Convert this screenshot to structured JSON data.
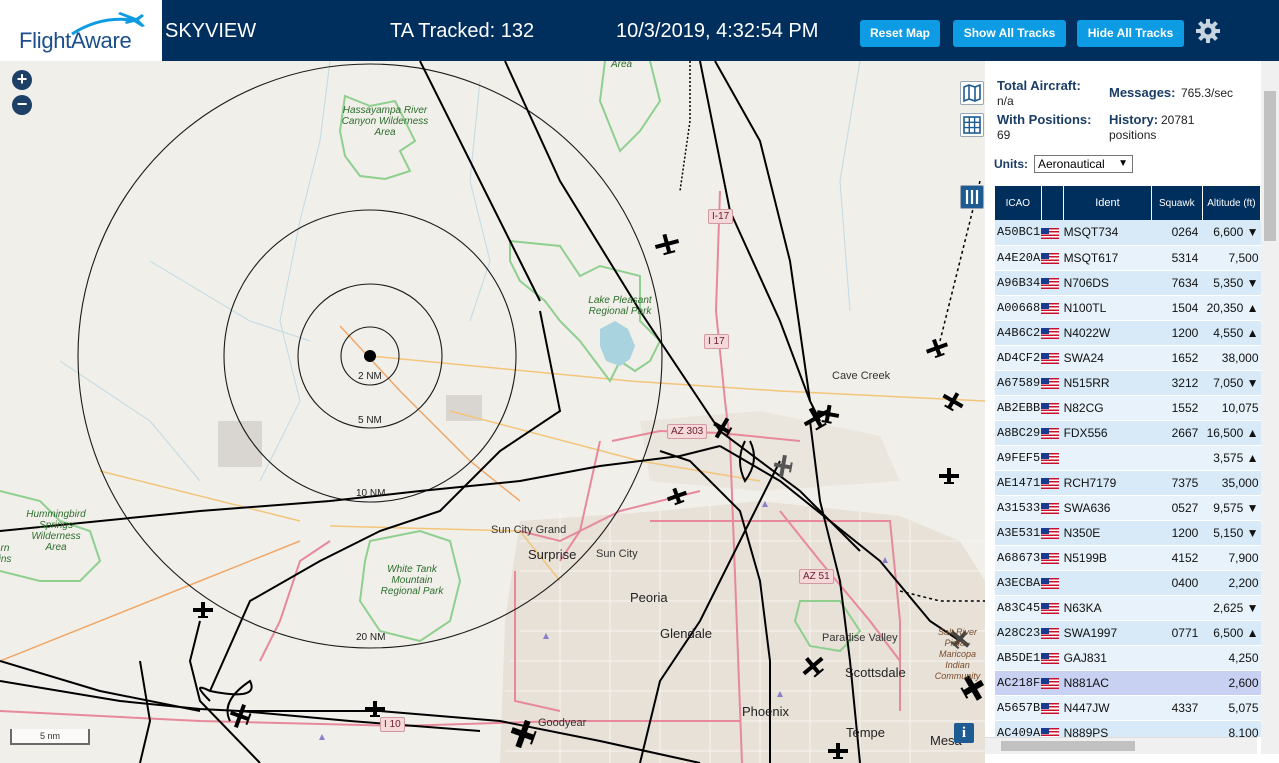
{
  "header": {
    "logo_text": "FlightAware",
    "title": "SKYVIEW",
    "tracked": "TA Tracked: 132",
    "datetime": "10/3/2019, 4:32:54 PM",
    "buttons": {
      "reset_map": "Reset Map",
      "show_all_tracks": "Show All Tracks",
      "hide_all_tracks": "Hide All Tracks"
    },
    "settings_icon": "gear-icon"
  },
  "map": {
    "zoom_in": "+",
    "zoom_out": "−",
    "scale": "5 nm",
    "info": "i",
    "range_rings": [
      "2 NM",
      "5 NM",
      "10 NM",
      "20 NM"
    ],
    "places": [
      "Cave Creek",
      "Sun City Grand",
      "Surprise",
      "Sun City",
      "Peoria",
      "Glendale",
      "Paradise Valley",
      "Scottsdale",
      "Phoenix",
      "Goodyear",
      "Tempe",
      "Mesa"
    ],
    "parks": [
      "Hassayampa River Canyon Wilderness Area",
      "Lake Pleasant Regional Park",
      "White Tank Mountain Regional Park",
      "Hummingbird Springs Wilderness Area",
      "Area",
      "rn ins",
      "Salt River Pima - Maricopa Indian Community"
    ],
    "highways": [
      "I-17",
      "I 17",
      "AZ 303",
      "AZ 51",
      "I 10"
    ],
    "controls": [
      "map-layers-icon",
      "grid-icon",
      "columns-icon"
    ],
    "colors": {
      "water": "#a9d3df",
      "park_outline": "#8fcf8f",
      "highway": "#e7899b",
      "track": "#000000"
    }
  },
  "sidebar": {
    "total_aircraft_label": "Total Aircraft:",
    "total_aircraft_value": "n/a",
    "with_positions_label": "With Positions:",
    "with_positions_value": "69",
    "messages_label": "Messages:",
    "messages_value": "765.3/sec",
    "history_label": "History:",
    "history_value": "20781",
    "history_unit": "positions",
    "units_label": "Units:",
    "units_value": "Aeronautical",
    "columns": [
      "ICAO",
      "",
      "Ident",
      "Squawk",
      "Altitude (ft)"
    ],
    "rows": [
      {
        "icao": "A50BC1",
        "ident": "MSQT734",
        "squawk": "0264",
        "alt": "6,600 ▼"
      },
      {
        "icao": "A4E20A",
        "ident": "MSQT617",
        "squawk": "5314",
        "alt": "7,500"
      },
      {
        "icao": "A96B34",
        "ident": "N706DS",
        "squawk": "7634",
        "alt": "5,350 ▼"
      },
      {
        "icao": "A00668",
        "ident": "N100TL",
        "squawk": "1504",
        "alt": "20,350 ▲"
      },
      {
        "icao": "A4B6C2",
        "ident": "N4022W",
        "squawk": "1200",
        "alt": "4,550 ▲"
      },
      {
        "icao": "AD4CF2",
        "ident": "SWA24",
        "squawk": "1652",
        "alt": "38,000"
      },
      {
        "icao": "A67589",
        "ident": "N515RR",
        "squawk": "3212",
        "alt": "7,050 ▼"
      },
      {
        "icao": "AB2EBB",
        "ident": "N82CG",
        "squawk": "1552",
        "alt": "10,075"
      },
      {
        "icao": "A8BC29",
        "ident": "FDX556",
        "squawk": "2667",
        "alt": "16,500 ▲"
      },
      {
        "icao": "A9FEF5",
        "ident": "",
        "squawk": "",
        "alt": "3,575 ▲"
      },
      {
        "icao": "AE1471",
        "ident": "RCH7179",
        "squawk": "7375",
        "alt": "35,000"
      },
      {
        "icao": "A31533",
        "ident": "SWA636",
        "squawk": "0527",
        "alt": "9,575 ▼"
      },
      {
        "icao": "A3E531",
        "ident": "N350E",
        "squawk": "1200",
        "alt": "5,150 ▼"
      },
      {
        "icao": "A68673",
        "ident": "N5199B",
        "squawk": "4152",
        "alt": "7,900"
      },
      {
        "icao": "A3ECBA",
        "ident": "",
        "squawk": "0400",
        "alt": "2,200"
      },
      {
        "icao": "A83C45",
        "ident": "N63KA",
        "squawk": "",
        "alt": "2,625 ▼"
      },
      {
        "icao": "A28C23",
        "ident": "SWA1997",
        "squawk": "0771",
        "alt": "6,500 ▲"
      },
      {
        "icao": "AB5DE1",
        "ident": "GAJ831",
        "squawk": "",
        "alt": "4,250"
      },
      {
        "icao": "AC218F",
        "ident": "N881AC",
        "squawk": "",
        "alt": "2,600",
        "selected": true
      },
      {
        "icao": "A5657B",
        "ident": "N447JW",
        "squawk": "4337",
        "alt": "5,075"
      },
      {
        "icao": "AC409A",
        "ident": "N889PS",
        "squawk": "",
        "alt": "8,100"
      }
    ]
  }
}
